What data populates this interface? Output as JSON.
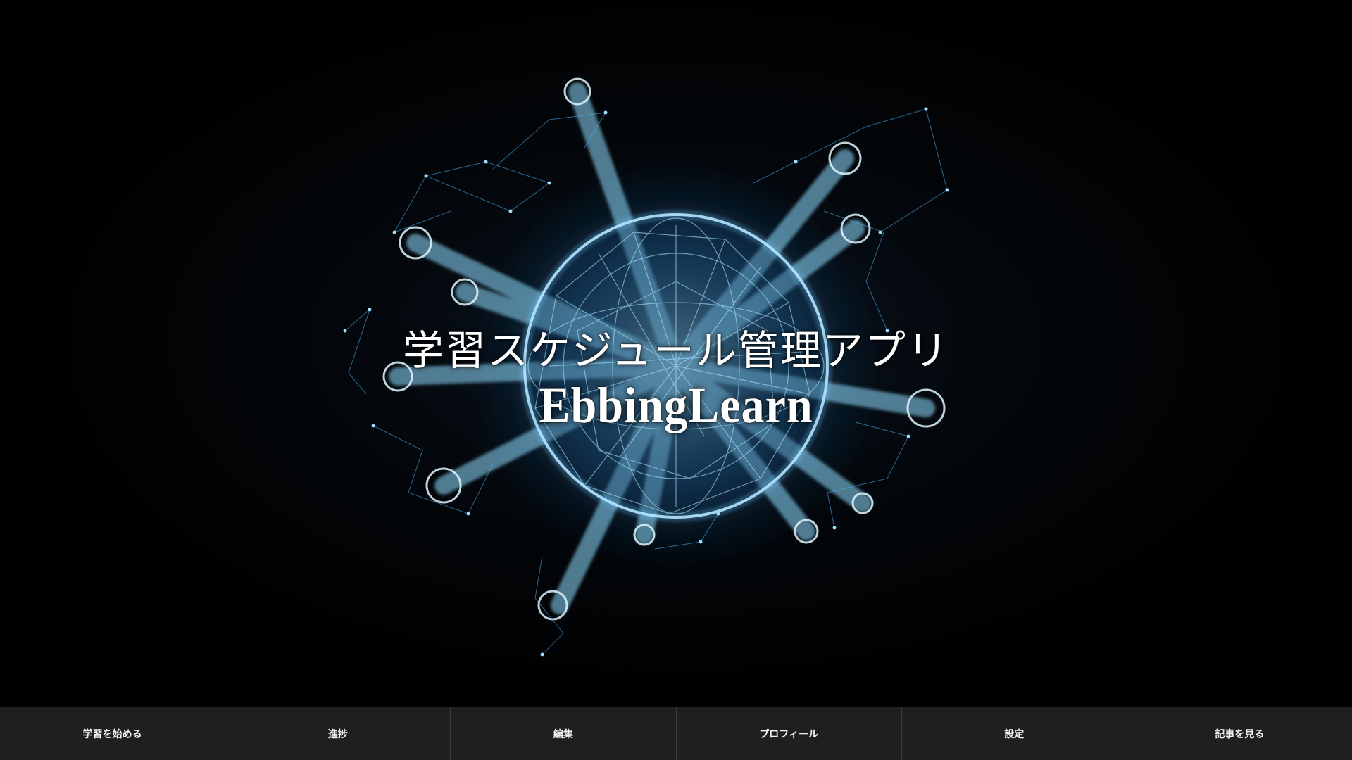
{
  "hero": {
    "title_jp": "学習スケジュール管理アプリ",
    "title_en": "EbbingLearn",
    "accent_color": "#5fd0ff"
  },
  "nav": {
    "items": [
      {
        "label": "学習を始める"
      },
      {
        "label": "進捗"
      },
      {
        "label": "編集"
      },
      {
        "label": "プロフィール"
      },
      {
        "label": "設定"
      },
      {
        "label": "記事を見る"
      }
    ]
  }
}
